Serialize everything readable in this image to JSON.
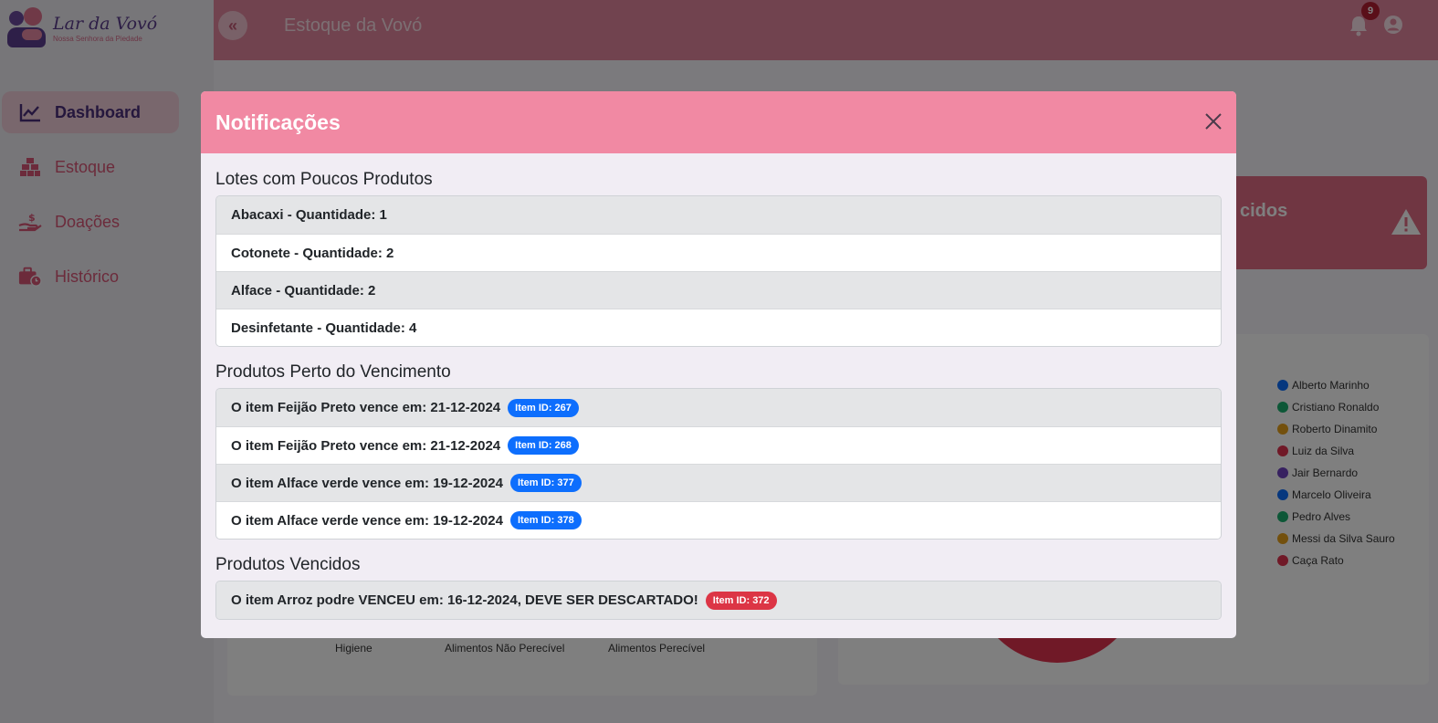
{
  "brand": {
    "name": "Lar da Vovó",
    "subtitle": "Nossa Senhora da Piedade"
  },
  "sidebar": {
    "items": [
      {
        "label": "Dashboard",
        "icon": "chart-line-icon",
        "active": true
      },
      {
        "label": "Estoque",
        "icon": "boxes-icon",
        "active": false
      },
      {
        "label": "Doações",
        "icon": "donation-hand-icon",
        "active": false
      },
      {
        "label": "Histórico",
        "icon": "briefcase-clock-icon",
        "active": false
      }
    ]
  },
  "header": {
    "title": "Estoque da Vovó",
    "notification_count": "9",
    "icons": [
      "double-chevron-left-icon",
      "bell-icon",
      "user-circle-icon"
    ]
  },
  "background": {
    "expired_card_title": "cidos",
    "bar_labels": [
      "Higiene",
      "Alimentos Não Perecível",
      "Alimentos Perecível"
    ],
    "legend": [
      {
        "name": "Alberto Marinho",
        "color": "#0d6efd"
      },
      {
        "name": "Cristiano Ronaldo",
        "color": "#1aae6f"
      },
      {
        "name": "Roberto Dinamito",
        "color": "#e6a11b"
      },
      {
        "name": "Luiz da Silva",
        "color": "#e0334f"
      },
      {
        "name": "Jair Bernardo",
        "color": "#6f42c1"
      },
      {
        "name": "Marcelo Oliveira",
        "color": "#0d6efd"
      },
      {
        "name": "Pedro Alves",
        "color": "#1aae6f"
      },
      {
        "name": "Messi da Silva Sauro",
        "color": "#e6a11b"
      },
      {
        "name": "Caça Rato",
        "color": "#e0334f"
      }
    ]
  },
  "modal": {
    "title": "Notificações",
    "sections": {
      "low_stock": {
        "title": "Lotes com Poucos Produtos",
        "items": [
          "Abacaxi - Quantidade: 1",
          "Cotonete - Quantidade: 2",
          "Alface - Quantidade: 2",
          "Desinfetante - Quantidade: 4"
        ]
      },
      "near_expiry": {
        "title": "Produtos Perto do Vencimento",
        "items": [
          {
            "text": "O item Feijão Preto vence em: 21-12-2024",
            "badge": "Item ID: 267"
          },
          {
            "text": "O item Feijão Preto vence em: 21-12-2024",
            "badge": "Item ID: 268"
          },
          {
            "text": "O item Alface verde vence em: 19-12-2024",
            "badge": "Item ID: 377"
          },
          {
            "text": "O item Alface verde vence em: 19-12-2024",
            "badge": "Item ID: 378"
          }
        ]
      },
      "expired": {
        "title": "Produtos Vencidos",
        "items": [
          {
            "text": "O item Arroz podre VENCEU em: 16-12-2024, DEVE SER DESCARTADO!",
            "badge": "Item ID: 372"
          }
        ]
      }
    }
  },
  "colors": {
    "primary_pink": "#f189a3",
    "accent_purple": "#5b3d8c",
    "badge_blue": "#0d6efd",
    "badge_red": "#dc3545"
  }
}
